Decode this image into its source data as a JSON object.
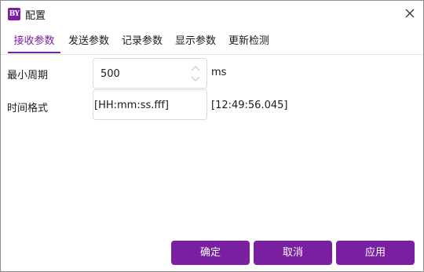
{
  "window": {
    "app_icon_text": "BY",
    "title": "配置"
  },
  "tabs": [
    {
      "label": "接收参数",
      "active": true
    },
    {
      "label": "发送参数",
      "active": false
    },
    {
      "label": "记录参数",
      "active": false
    },
    {
      "label": "显示参数",
      "active": false
    },
    {
      "label": "更新检测",
      "active": false
    }
  ],
  "form": {
    "min_period": {
      "label": "最小周期",
      "value": "500",
      "unit": "ms"
    },
    "time_format": {
      "label": "时间格式",
      "value": "[HH:mm:ss.fff]",
      "preview": "[12:49:56.045]"
    }
  },
  "buttons": {
    "ok": "确定",
    "cancel": "取消",
    "apply": "应用"
  },
  "colors": {
    "accent": "#7a1fa2",
    "border": "#dadada"
  }
}
